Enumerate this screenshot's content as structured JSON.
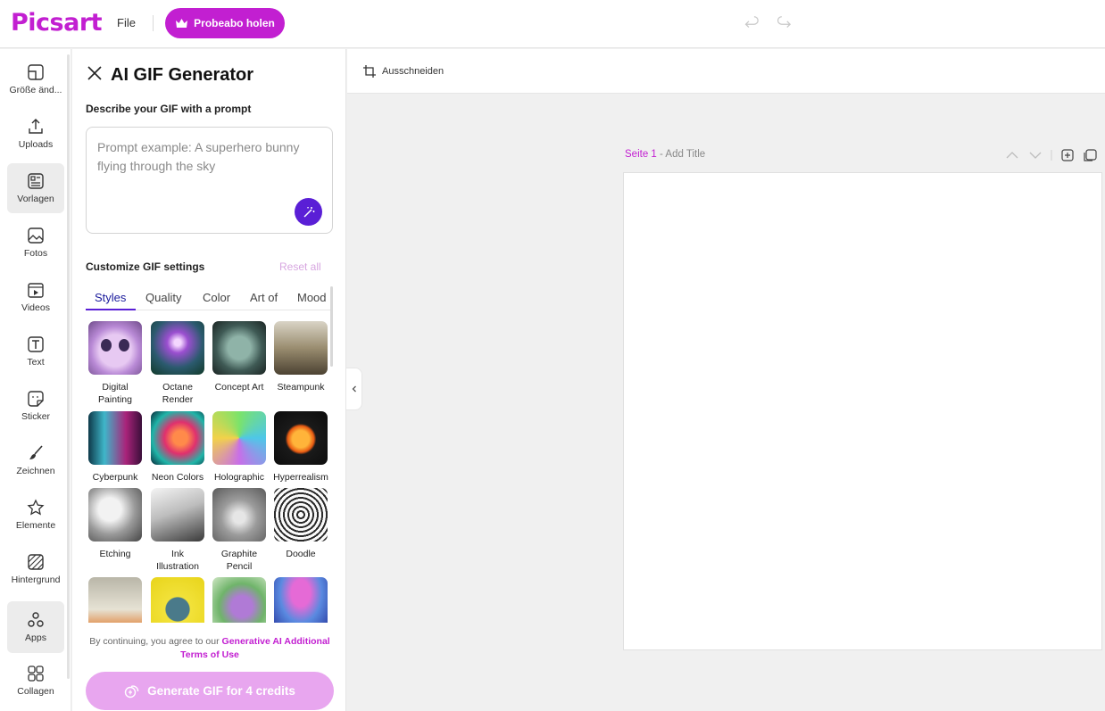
{
  "header": {
    "logo": "Picsart",
    "file_label": "File",
    "trial_label": "Probeabo holen"
  },
  "sidebar": {
    "items": [
      {
        "label": "Größe änd...",
        "icon": "resize-icon"
      },
      {
        "label": "Uploads",
        "icon": "upload-icon"
      },
      {
        "label": "Vorlagen",
        "icon": "templates-icon"
      },
      {
        "label": "Fotos",
        "icon": "photo-icon"
      },
      {
        "label": "Videos",
        "icon": "video-icon"
      },
      {
        "label": "Text",
        "icon": "text-icon"
      },
      {
        "label": "Sticker",
        "icon": "sticker-icon"
      },
      {
        "label": "Zeichnen",
        "icon": "brush-icon"
      },
      {
        "label": "Elemente",
        "icon": "star-icon"
      },
      {
        "label": "Hintergrund",
        "icon": "background-icon"
      },
      {
        "label": "Apps",
        "icon": "apps-icon"
      },
      {
        "label": "Collagen",
        "icon": "collage-icon"
      }
    ]
  },
  "panel": {
    "title": "AI GIF Generator",
    "prompt_label": "Describe your GIF with a prompt",
    "prompt_placeholder": "Prompt example: A superhero bunny flying through the sky",
    "prompt_value": "",
    "customize_label": "Customize GIF settings",
    "reset_label": "Reset all",
    "tabs": [
      "Styles",
      "Quality",
      "Color",
      "Art of",
      "Mood"
    ],
    "styles": [
      {
        "label": "Digital Painting"
      },
      {
        "label": "Octane Render"
      },
      {
        "label": "Concept Art"
      },
      {
        "label": "Steampunk"
      },
      {
        "label": "Cyberpunk"
      },
      {
        "label": "Neon Colors"
      },
      {
        "label": "Holographic"
      },
      {
        "label": "Hyperrealism"
      },
      {
        "label": "Etching"
      },
      {
        "label": "Ink Illustration"
      },
      {
        "label": "Graphite Pencil"
      },
      {
        "label": "Doodle"
      },
      {
        "label": ""
      },
      {
        "label": ""
      },
      {
        "label": ""
      },
      {
        "label": ""
      }
    ],
    "terms_prefix": "By continuing, you agree to our",
    "terms_link": "Generative AI Additional Terms of Use",
    "generate_label": "Generate GIF for 4 credits"
  },
  "toolbar": {
    "crop_label": "Ausschneiden"
  },
  "page": {
    "page_name": "Seite 1",
    "separator": " - ",
    "title_placeholder": "Add Title"
  },
  "colors": {
    "brand": "#c21fd1",
    "accent": "#5a1fd6",
    "generate_disabled": "#e8a6ef"
  }
}
